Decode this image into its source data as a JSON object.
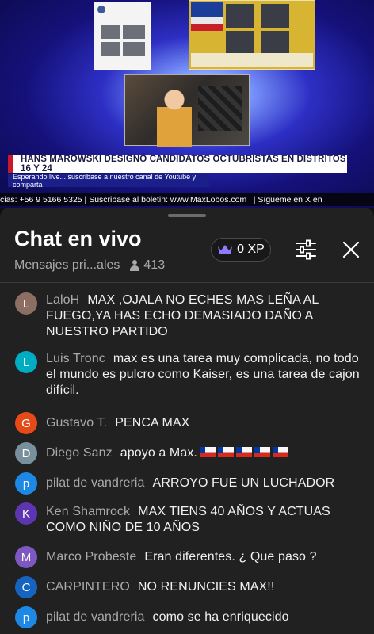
{
  "video": {
    "headline": "HANS MAROWSKI DESIGNÓ CANDIDATOS OCTUBRISTAS EN DISTRITOS 16 Y 24",
    "subheadline": "Esperando live... suscribase a nuestro canal de Youtube y comparta",
    "ticker": "cias: +56 9 5166 5325 | Suscribase al boletin: www.MaxLobos.com |                   | Sígueme en X en",
    "thumb_post_icon": "social-post-thumbnail",
    "thumb_panel_icon": "news-panel-thumbnail",
    "thumb_studio_icon": "studio-thumbnail",
    "headline_accent": "#c9182b"
  },
  "chat": {
    "title": "Chat en vivo",
    "mode_label": "Mensajes pri...ales",
    "viewer_count": "413",
    "xp_label": "0 XP",
    "icons": {
      "crown": "crown-icon",
      "filter": "sliders-icon",
      "close": "close-icon",
      "viewers": "person-icon"
    },
    "messages": [
      {
        "initial": "L",
        "color": "#8d6e63",
        "author": "LaloH",
        "text": "MAX ,OJALA NO ECHES MAS LEÑA AL FUEGO,YA HAS ECHO DEMASIADO DAÑO A NUESTRO PARTIDO"
      },
      {
        "initial": "L",
        "color": "#00acc1",
        "author": "Luis Tronc",
        "text": "max es una tarea muy complicada, no todo el mundo es pulcro como Kaiser, es una tarea de cajon difícil."
      },
      {
        "initial": "G",
        "color": "#e64a19",
        "author": "Gustavo T.",
        "text": "PENCA MAX"
      },
      {
        "initial": "D",
        "color": "#78909c",
        "author": "Diego Sanz",
        "text": "apoyo a Max.",
        "flags": 5
      },
      {
        "initial": "p",
        "color": "#1e88e5",
        "author": "pilat de vandreria",
        "text": "ARROYO FUE UN LUCHADOR"
      },
      {
        "initial": "K",
        "color": "#5e35b1",
        "author": "Ken Shamrock",
        "text": "MAX TIENS 40 AÑOS Y ACTUAS COMO NIÑO DE 10 AÑOS"
      },
      {
        "initial": "M",
        "color": "#7e57c2",
        "author": "Marco Probeste",
        "text": "Eran diferentes. ¿ Que paso ?"
      },
      {
        "initial": "C",
        "color": "#1565c0",
        "author": "CARPINTERO",
        "text": "NO RENUNCIES MAX!!"
      },
      {
        "initial": "p",
        "color": "#1e88e5",
        "author": "pilat de vandreria",
        "text": "como se ha enriquecido"
      }
    ]
  }
}
